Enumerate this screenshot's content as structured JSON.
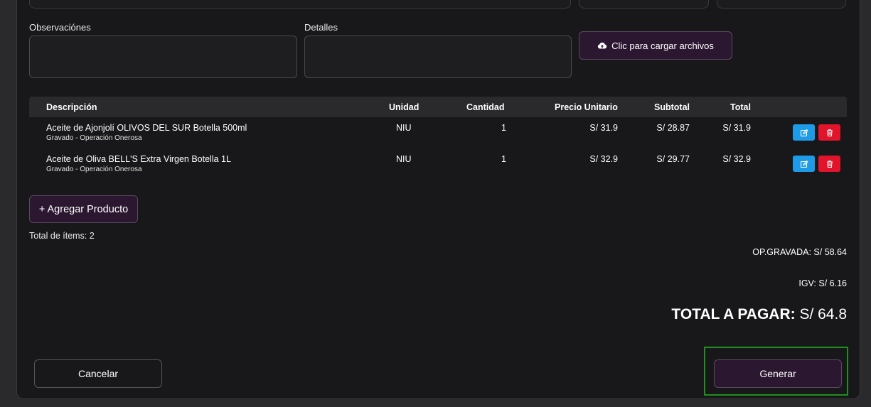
{
  "form": {
    "observaciones_label": "Observaciónes",
    "detalles_label": "Detalles",
    "observaciones_value": "",
    "detalles_value": "",
    "upload_label": "Clic para cargar archivos"
  },
  "table": {
    "headers": [
      "Descripción",
      "Unidad",
      "Cantidad",
      "Precio Unitario",
      "Subtotal",
      "Total"
    ],
    "rows": [
      {
        "description": "Aceite de Ajonjolí OLIVOS DEL SUR Botella 500ml",
        "sub": "Gravado - Operación Onerosa",
        "unit": "NIU",
        "qty": "1",
        "price": "S/ 31.9",
        "subtotal": "S/ 28.87",
        "total": "S/ 31.9"
      },
      {
        "description": "Aceite de Oliva BELL'S Extra Virgen Botella 1L",
        "sub": "Gravado - Operación Onerosa",
        "unit": "NIU",
        "qty": "1",
        "price": "S/ 32.9",
        "subtotal": "S/ 29.77",
        "total": "S/ 32.9"
      }
    ]
  },
  "actions": {
    "add_product": "+ Agregar Producto",
    "items_count": "Total de ítems: 2",
    "cancel": "Cancelar",
    "generate": "Generar"
  },
  "totals": {
    "op_gravada": "OP.GRAVADA: S/ 58.64",
    "igv": "IGV: S/ 6.16",
    "total_label": "TOTAL A PAGAR:",
    "total_value": " S/ 64.8"
  },
  "icons": {
    "upload": "cloud-upload-icon",
    "edit": "pencil-icon",
    "delete": "trash-icon"
  },
  "colors": {
    "accent_purple": "#2b1730",
    "edit_blue": "#1e9be6",
    "delete_red": "#e0142a",
    "focus_green": "#1f8f1f"
  }
}
